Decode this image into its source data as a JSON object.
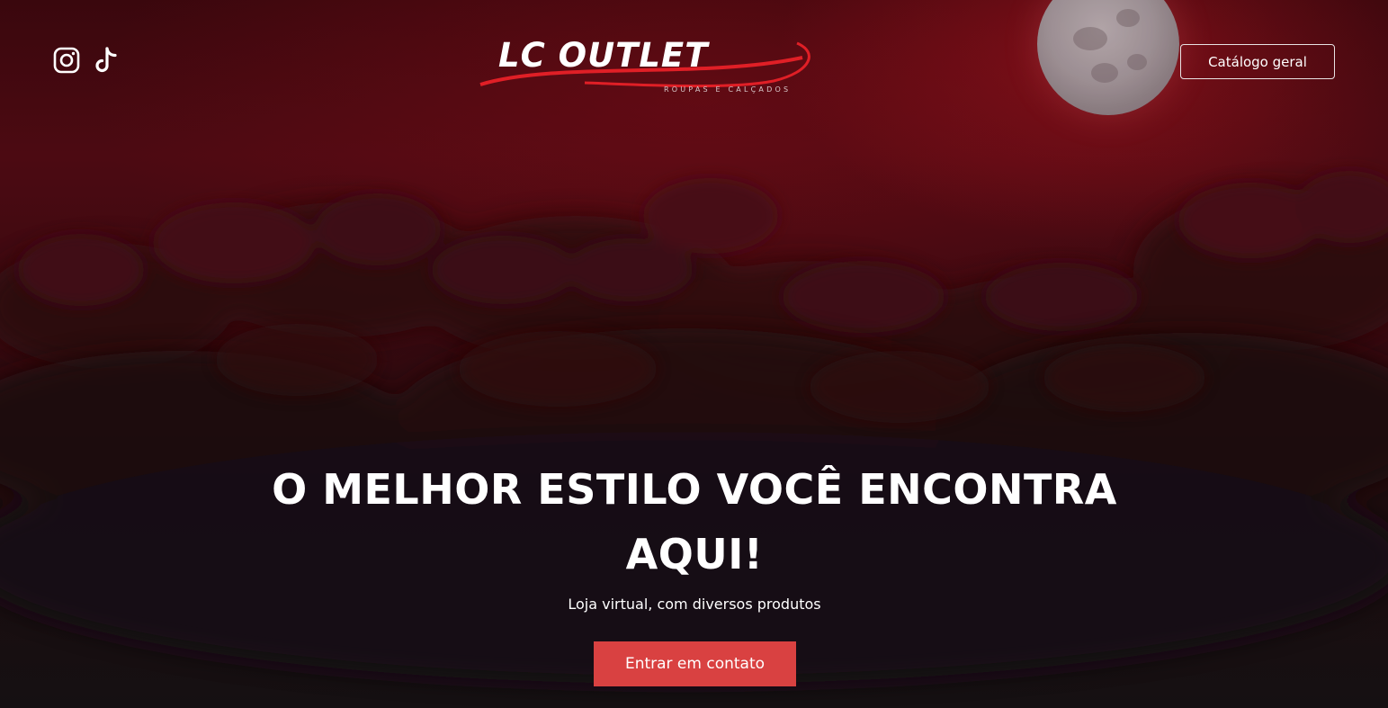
{
  "header": {
    "social": [
      {
        "icon": "instagram-icon"
      },
      {
        "icon": "tiktok-icon"
      }
    ],
    "logo": {
      "title": "LC OUTLET",
      "subtitle": "ROUPAS E CALÇADOS"
    },
    "catalog_button": "Catálogo geral"
  },
  "hero": {
    "headline_line1": "O MELHOR ESTILO VOCÊ ENCONTRA",
    "headline_line2": "AQUI!",
    "subtitle": "Loja virtual, com diversos produtos",
    "cta_button": "Entrar em contato"
  },
  "colors": {
    "accent": "#d94141",
    "logo_swoosh": "#e01f26",
    "background_dark": "#140a0b",
    "background_red": "#4c0a12"
  }
}
